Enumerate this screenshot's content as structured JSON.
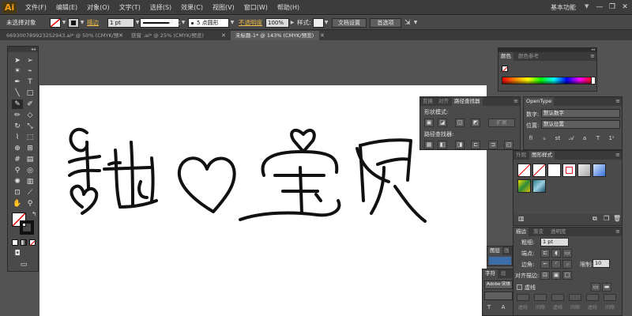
{
  "app": {
    "logo": "Ai"
  },
  "menu": [
    "文件(F)",
    "编辑(E)",
    "对象(O)",
    "文字(T)",
    "选择(S)",
    "效果(C)",
    "视图(V)",
    "窗口(W)",
    "帮助(H)"
  ],
  "workspace": "基本功能",
  "window_controls": {
    "minimize": "—",
    "restore": "❐",
    "close": "✕"
  },
  "control": {
    "selection_status": "未选择对象",
    "stroke_label": "描边",
    "stroke_weight": "1 pt",
    "stroke_profile_label": "等比",
    "brush": "5 点圆形",
    "opacity_label": "不透明度",
    "opacity_value": "100%",
    "style_label": "样式:",
    "doc_settings": "文档设置",
    "preferences": "首选项"
  },
  "tabs": [
    {
      "label": "6693007899232S2943.ai* @ 50% (CMYK/预览)",
      "active": false
    },
    {
      "label": "获窗 .ai* @ 25% (CMYK/预览)",
      "active": false
    },
    {
      "label": "未标题-1* @ 143% (CMYK/预览)",
      "active": true
    }
  ],
  "color_panel": {
    "tabs": [
      "颜色",
      "颜色参考"
    ]
  },
  "pathfinder_panel": {
    "tabs": [
      "变换",
      "对齐",
      "路径查找器"
    ],
    "shape_modes_label": "形状模式:",
    "expand_button": "扩展",
    "pathfinders_label": "路径查找器:"
  },
  "opentype_panel": {
    "tab": "OpenType",
    "figure_label": "数字:",
    "figure_value": "默认数字",
    "position_label": "位置:",
    "position_value": "默认位置"
  },
  "styles_panel": {
    "tabs": [
      "外观",
      "图形样式"
    ]
  },
  "stroke_panel": {
    "tabs": [
      "描边",
      "渐变",
      "透明度"
    ],
    "weight_label": "粗细:",
    "weight_value": "1 pt",
    "cap_label": "端点:",
    "corner_label": "边角:",
    "limit_label": "限制:",
    "limit_value": "10",
    "align_label": "对齐描边:",
    "dashed_label": "虚线",
    "dash_labels": [
      "虚线",
      "间隙",
      "虚线",
      "间隙",
      "虚线",
      "间隙"
    ]
  },
  "small_tabs": {
    "layers": [
      "图层",
      "画"
    ],
    "character": [
      "字符",
      "段"
    ]
  },
  "character_panel": {
    "font_value": "Adobe 宋体"
  },
  "colors": {
    "accent": "#f7a01c",
    "ui_dark": "#535353",
    "panel": "#4a4a4a"
  }
}
